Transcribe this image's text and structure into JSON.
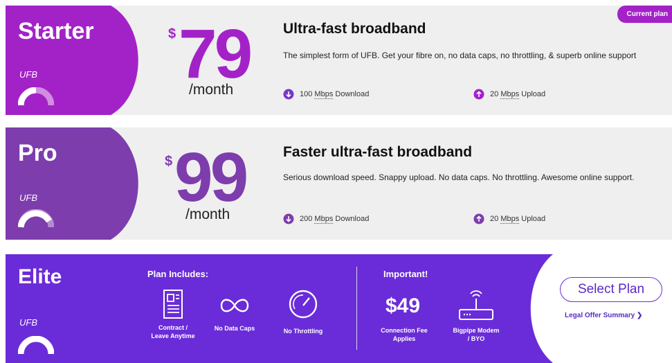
{
  "colors": {
    "starter": "#a322c8",
    "pro": "#7d3dad",
    "elite": "#6a2cd8",
    "gray": "#efefef"
  },
  "plans": [
    {
      "name": "Starter",
      "type": "UFB",
      "currency": "$",
      "price": "79",
      "per": "/month",
      "title": "Ultra-fast broadband",
      "description": "The simplest form of UFB. Get your fibre on, no data caps, no throttling, & superb online support",
      "download": {
        "speed": "100",
        "unit": "Mbps",
        "label": "Download"
      },
      "upload": {
        "speed": "20",
        "unit": "Mbps",
        "label": "Upload"
      },
      "badge": "Current plan"
    },
    {
      "name": "Pro",
      "type": "UFB",
      "currency": "$",
      "price": "99",
      "per": "/month",
      "title": "Faster ultra-fast broadband",
      "description": "Serious download speed. Snappy upload. No data caps. No throttling. Awesome online support.",
      "download": {
        "speed": "200",
        "unit": "Mbps",
        "label": "Download"
      },
      "upload": {
        "speed": "20",
        "unit": "Mbps",
        "label": "Upload"
      }
    },
    {
      "name": "Elite",
      "type": "UFB",
      "includes_heading": "Plan Includes:",
      "includes": [
        {
          "icon": "contract-icon",
          "label1": "Contract /",
          "label2": "Leave Anytime"
        },
        {
          "icon": "infinity-icon",
          "label1": "No Data Caps",
          "label2": ""
        },
        {
          "icon": "speedometer-icon",
          "label1": "No Throttling",
          "label2": ""
        }
      ],
      "important_heading": "Important!",
      "fee": {
        "amount": "$49",
        "label1": "Connection Fee",
        "label2": "Applies"
      },
      "modem": {
        "icon": "router-icon",
        "label1": "Bigpipe Modem",
        "label2": "/ BYO"
      },
      "select_label": "Select Plan",
      "legal_label": "Legal Offer Summary"
    }
  ]
}
